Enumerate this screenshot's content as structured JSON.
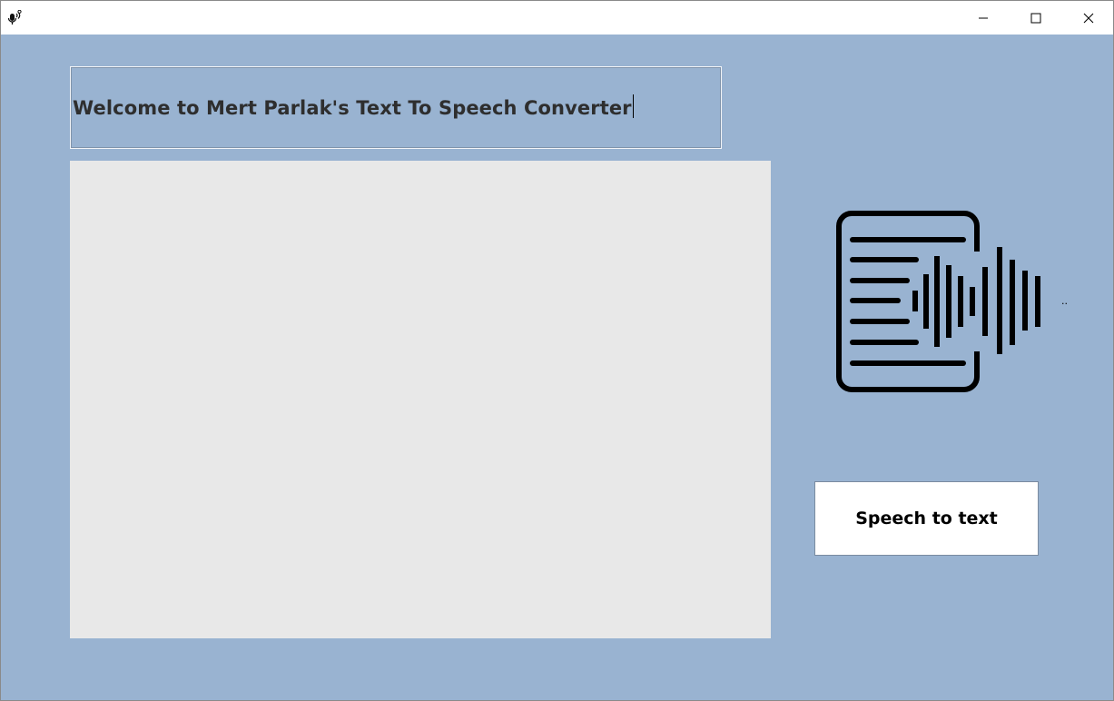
{
  "window": {
    "icon": "microphone-speech-icon",
    "controls": {
      "minimize_icon": "minimize-icon",
      "maximize_icon": "maximize-icon",
      "close_icon": "close-icon"
    }
  },
  "main": {
    "title_text": "Welcome to Mert Parlak's Text To Speech Converter",
    "text_area_value": "",
    "illustration_icon": "text-to-speech-document-waveform-icon",
    "side_marker": "..",
    "speech_to_text_label": "Speech to text"
  },
  "colors": {
    "background": "#99b3d1",
    "text_area": "#e8e8e8",
    "button": "#ffffff",
    "title_text": "#2e2e2e"
  }
}
